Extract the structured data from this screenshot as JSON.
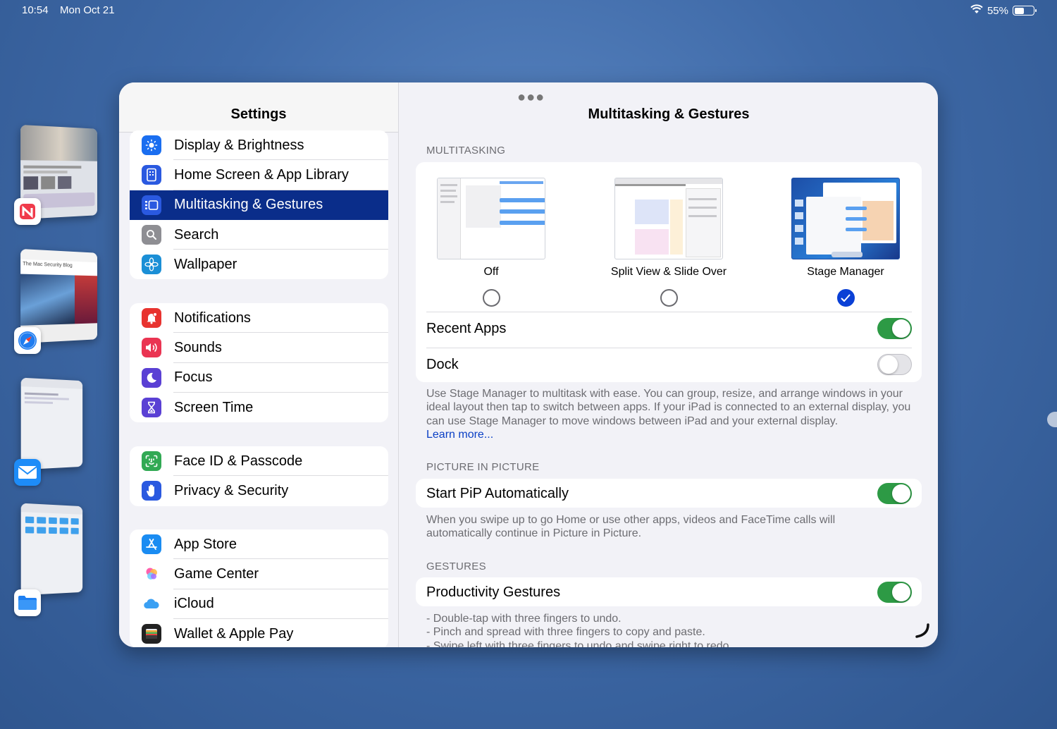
{
  "status_bar": {
    "time": "10:54",
    "date": "Mon Oct 21",
    "battery_percent": "55%",
    "battery_level": 0.55
  },
  "stage_apps": [
    {
      "icon": "news-icon",
      "color": "#f03b4b"
    },
    {
      "icon": "safari-icon",
      "color": "#1f7df0"
    },
    {
      "icon": "mail-icon",
      "color": "#1d8cf8"
    },
    {
      "icon": "files-icon",
      "color": "#1e7ff2"
    }
  ],
  "sidebar": {
    "title": "Settings",
    "groups": [
      {
        "items": [
          {
            "label": "Display & Brightness",
            "icon": "sun-icon",
            "color": "#1a6ef0"
          },
          {
            "label": "Home Screen & App Library",
            "icon": "home-screen-icon",
            "color": "#2a59e0"
          },
          {
            "label": "Multitasking & Gestures",
            "icon": "multitasking-icon",
            "color": "#2a59e0",
            "selected": true
          },
          {
            "label": "Search",
            "icon": "search-icon",
            "color": "#8e8e93"
          },
          {
            "label": "Wallpaper",
            "icon": "flower-icon",
            "color": "#1b8fd6"
          }
        ]
      },
      {
        "items": [
          {
            "label": "Notifications",
            "icon": "bell-icon",
            "color": "#e8332f"
          },
          {
            "label": "Sounds",
            "icon": "speaker-icon",
            "color": "#ea3452"
          },
          {
            "label": "Focus",
            "icon": "moon-icon",
            "color": "#5a40d4"
          },
          {
            "label": "Screen Time",
            "icon": "hourglass-icon",
            "color": "#5a40d4"
          }
        ]
      },
      {
        "items": [
          {
            "label": "Face ID & Passcode",
            "icon": "face-id-icon",
            "color": "#31a954"
          },
          {
            "label": "Privacy & Security",
            "icon": "hand-icon",
            "color": "#2a59e0"
          }
        ]
      },
      {
        "items": [
          {
            "label": "App Store",
            "icon": "app-store-icon",
            "color": "#1a8cf2"
          },
          {
            "label": "Game Center",
            "icon": "game-center-icon",
            "color": "#ffffff"
          },
          {
            "label": "iCloud",
            "icon": "cloud-icon",
            "color": "#ffffff"
          },
          {
            "label": "Wallet & Apple Pay",
            "icon": "wallet-icon",
            "color": "#222222"
          }
        ]
      }
    ]
  },
  "detail": {
    "title": "Multitasking & Gestures",
    "multitasking": {
      "section_title": "MULTITASKING",
      "options": [
        {
          "label": "Off",
          "checked": false
        },
        {
          "label": "Split View & Slide Over",
          "checked": false
        },
        {
          "label": "Stage Manager",
          "checked": true
        }
      ],
      "recent_apps": {
        "label": "Recent Apps",
        "on": true
      },
      "dock": {
        "label": "Dock",
        "on": false
      },
      "footnote": "Use Stage Manager to multitask with ease. You can group, resize, and arrange windows in your ideal layout then tap to switch between apps. If your iPad is connected to an external display, you can use Stage Manager to move windows between iPad and your external display.",
      "learn_more": "Learn more..."
    },
    "pip": {
      "section_title": "PICTURE IN PICTURE",
      "start_pip": {
        "label": "Start PiP Automatically",
        "on": true
      },
      "footnote": "When you swipe up to go Home or use other apps, videos and FaceTime calls will automatically continue in Picture in Picture."
    },
    "gestures": {
      "section_title": "GESTURES",
      "productivity": {
        "label": "Productivity Gestures",
        "on": true
      },
      "footnote_lines": [
        "- Double-tap with three fingers to undo.",
        "- Pinch and spread with three fingers to copy and paste.",
        "- Swipe left with three fingers to undo and swipe right to redo."
      ]
    }
  }
}
